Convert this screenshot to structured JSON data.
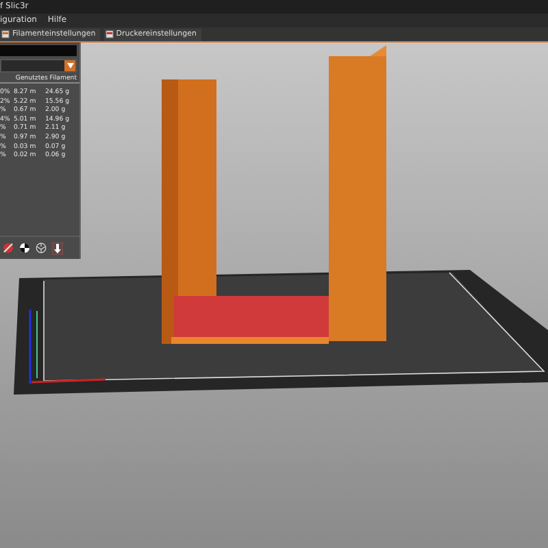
{
  "window": {
    "title": "f Slic3r"
  },
  "menu": [
    "iguration",
    "Hilfe"
  ],
  "tabs": [
    {
      "label": "Filamenteinstellungen",
      "selected": false
    },
    {
      "label": "Druckereinstellungen",
      "selected": false
    }
  ],
  "panel": {
    "header": "Genutztes Filament",
    "rows": [
      {
        "column_1": "0%",
        "length": "8.27 m",
        "weight": "24.65 g"
      },
      {
        "column_1": "2%",
        "length": "5.22 m",
        "weight": "15.56 g"
      },
      {
        "column_1": "%",
        "length": "0.67 m",
        "weight": "2.00 g"
      },
      {
        "column_1": "4%",
        "length": "5.01 m",
        "weight": "14.96 g"
      },
      {
        "column_1": "%",
        "length": "0.71 m",
        "weight": "2.11 g"
      },
      {
        "column_1": "%",
        "length": "0.97 m",
        "weight": "2.90 g"
      },
      {
        "column_1": "%",
        "length": "0.03 m",
        "weight": "0.07 g"
      },
      {
        "column_1": "%",
        "length": "0.02 m",
        "weight": "0.06 g"
      }
    ]
  }
}
